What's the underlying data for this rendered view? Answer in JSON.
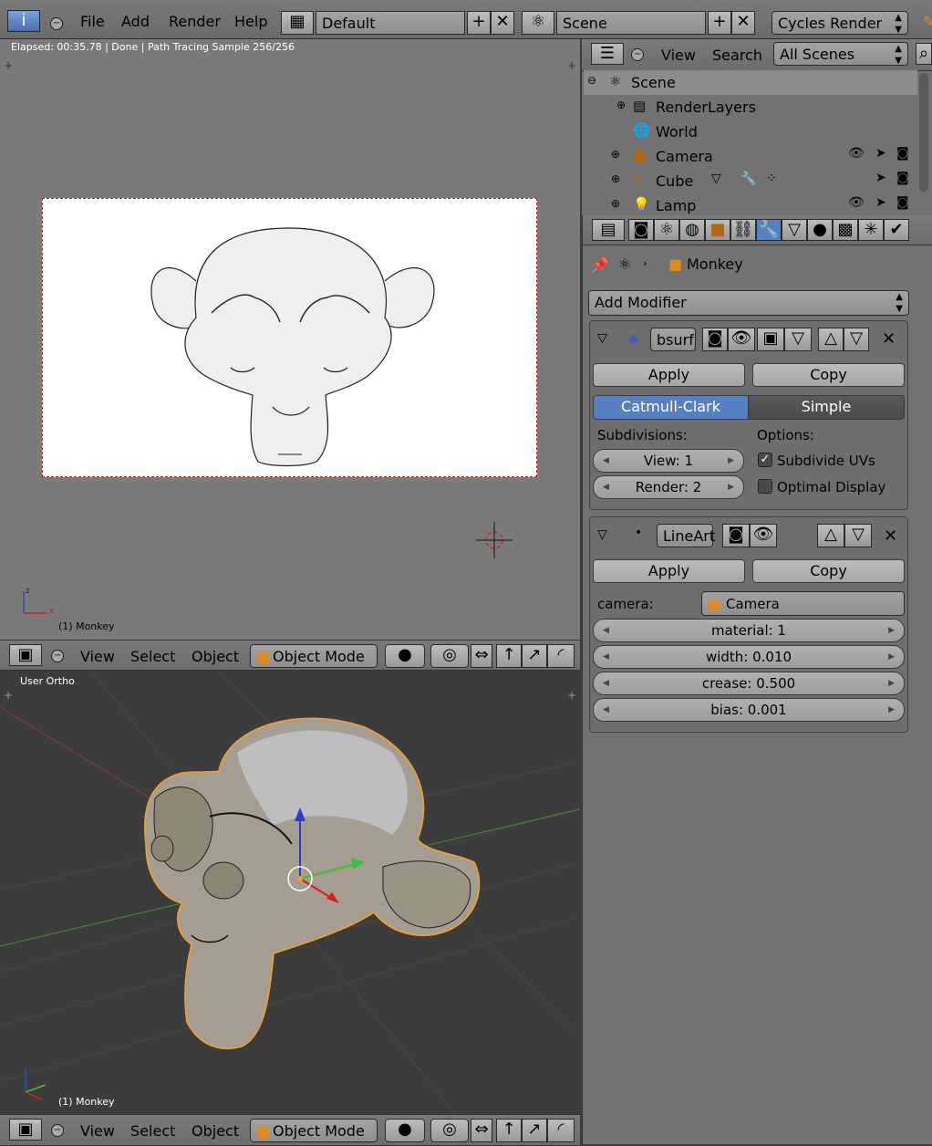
{
  "topbar": {
    "menus": [
      "File",
      "Add",
      "Render",
      "Help"
    ],
    "layout": "Default",
    "scene": "Scene",
    "engine": "Cycles Render"
  },
  "render_view": {
    "status": "Elapsed: 00:35.78 | Done | Path Tracing Sample 256/256",
    "object_label": "(1) Monkey",
    "header": {
      "menus": [
        "View",
        "Select",
        "Object"
      ],
      "mode": "Object Mode"
    }
  },
  "viewport": {
    "view_label": "User Ortho",
    "object_label": "(1) Monkey",
    "header": {
      "menus": [
        "View",
        "Select",
        "Object"
      ],
      "mode": "Object Mode"
    }
  },
  "outliner": {
    "menus": [
      "View",
      "Search"
    ],
    "filter": "All Scenes",
    "items": [
      {
        "label": "Scene",
        "icon": "scene-icon"
      },
      {
        "label": "RenderLayers",
        "icon": "render-layers-icon"
      },
      {
        "label": "World",
        "icon": "world-icon"
      },
      {
        "label": "Camera",
        "icon": "camera-icon"
      },
      {
        "label": "Cube",
        "icon": "mesh-icon"
      },
      {
        "label": "Lamp",
        "icon": "lamp-icon"
      }
    ]
  },
  "properties": {
    "breadcrumb_object": "Monkey",
    "add_modifier": "Add Modifier",
    "modifiers": [
      {
        "name": "bsurf",
        "apply": "Apply",
        "copy": "Copy",
        "tabs": [
          "Catmull-Clark",
          "Simple"
        ],
        "active_tab": "Catmull-Clark",
        "subdivisions_label": "Subdivisions:",
        "options_label": "Options:",
        "view": "View: 1",
        "render": "Render: 2",
        "subdivide_uvs": "Subdivide UVs",
        "optimal_display": "Optimal Display",
        "subdivide_uvs_checked": true,
        "optimal_display_checked": false
      },
      {
        "name": "LineArt",
        "apply": "Apply",
        "copy": "Copy",
        "camera_label": "camera:",
        "camera_value": "Camera",
        "material": "material: 1",
        "width": "width: 0.010",
        "crease": "crease: 0.500",
        "bias": "bias: 0.001"
      }
    ]
  },
  "colors": {
    "active_tab": "#5680c2",
    "selection_outline": "#f0a030",
    "render_border": "#b52222"
  }
}
